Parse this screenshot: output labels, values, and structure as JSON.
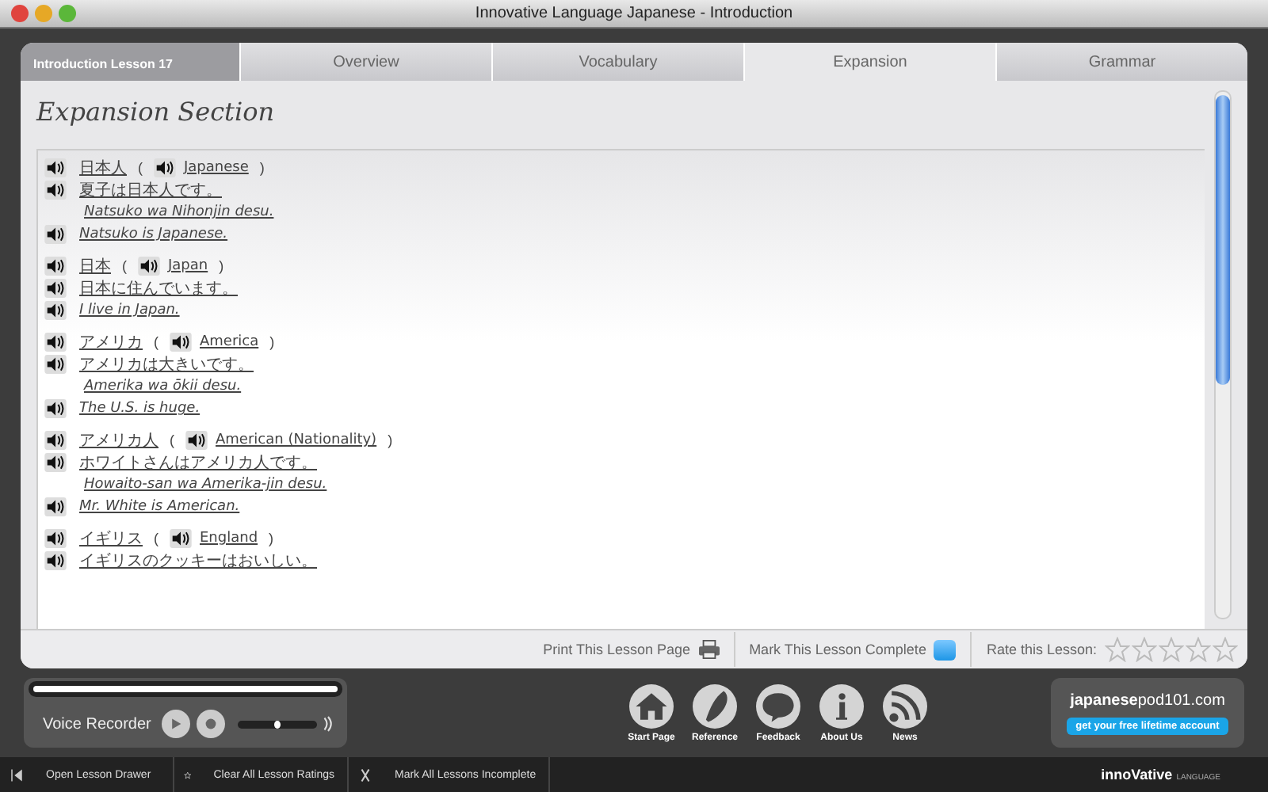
{
  "window": {
    "title": "Innovative Language Japanese - Introduction"
  },
  "lesson_label": "Introduction Lesson 17",
  "tabs": [
    {
      "label": "Overview",
      "selected": false
    },
    {
      "label": "Vocabulary",
      "selected": false
    },
    {
      "label": "Expansion",
      "selected": true
    },
    {
      "label": "Grammar",
      "selected": false
    }
  ],
  "section_title": "Expansion Section",
  "groups": [
    {
      "word": "日本人",
      "open": "(",
      "translation": "Japanese",
      "close": ")",
      "lines": [
        {
          "kind": "jp",
          "audio": true,
          "text": "夏子は日本人です。"
        },
        {
          "kind": "romaji",
          "audio": false,
          "text": "Natsuko wa Nihonjin desu."
        },
        {
          "kind": "en",
          "audio": true,
          "text": "Natsuko is Japanese."
        }
      ]
    },
    {
      "word": "日本",
      "open": "(",
      "translation": "Japan",
      "close": ")",
      "lines": [
        {
          "kind": "jp",
          "audio": true,
          "text": "日本に住んでいます。"
        },
        {
          "kind": "en",
          "audio": true,
          "text": "I live in Japan."
        }
      ]
    },
    {
      "word": "アメリカ",
      "open": "(",
      "translation": "America",
      "close": ")",
      "lines": [
        {
          "kind": "jp",
          "audio": true,
          "text": "アメリカは大きいです。"
        },
        {
          "kind": "romaji",
          "audio": false,
          "text": "Amerika wa ōkii desu."
        },
        {
          "kind": "en",
          "audio": true,
          "text": "The U.S. is huge."
        }
      ]
    },
    {
      "word": "アメリカ人",
      "open": "(",
      "translation": "American (Nationality)",
      "close": ")",
      "lines": [
        {
          "kind": "jp",
          "audio": true,
          "text": "ホワイトさんはアメリカ人です。"
        },
        {
          "kind": "romaji",
          "audio": false,
          "text": "Howaito-san wa Amerika-jin desu."
        },
        {
          "kind": "en",
          "audio": true,
          "text": "Mr. White is American."
        }
      ]
    },
    {
      "word": "イギリス",
      "open": "(",
      "translation": "England",
      "close": ")",
      "lines": [
        {
          "kind": "jp",
          "audio": true,
          "text": "イギリスのクッキーはおいしい。"
        }
      ]
    }
  ],
  "footer": {
    "print": "Print This Lesson Page",
    "complete": "Mark This Lesson Complete",
    "rate": "Rate this Lesson:",
    "stars": 0
  },
  "recorder": {
    "label": "Voice Recorder",
    "level": 0.5
  },
  "nav": [
    {
      "kind": "home",
      "label": "Start Page"
    },
    {
      "kind": "feather",
      "label": "Reference"
    },
    {
      "kind": "bubble",
      "label": "Feedback"
    },
    {
      "kind": "info",
      "label": "About Us"
    },
    {
      "kind": "rss",
      "label": "News"
    }
  ],
  "promo": {
    "site_bold": "japanese",
    "site_rest": "pod101.com",
    "button": "get your free lifetime account"
  },
  "bottom_bar": [
    {
      "kind": "drawer",
      "label": "Open Lesson Drawer"
    },
    {
      "kind": "star",
      "label": "Clear All Lesson Ratings"
    },
    {
      "kind": "cross",
      "label": "Mark All Lessons Incomplete"
    }
  ],
  "brand": {
    "name": "innoVative",
    "sub": "LANGUAGE"
  }
}
